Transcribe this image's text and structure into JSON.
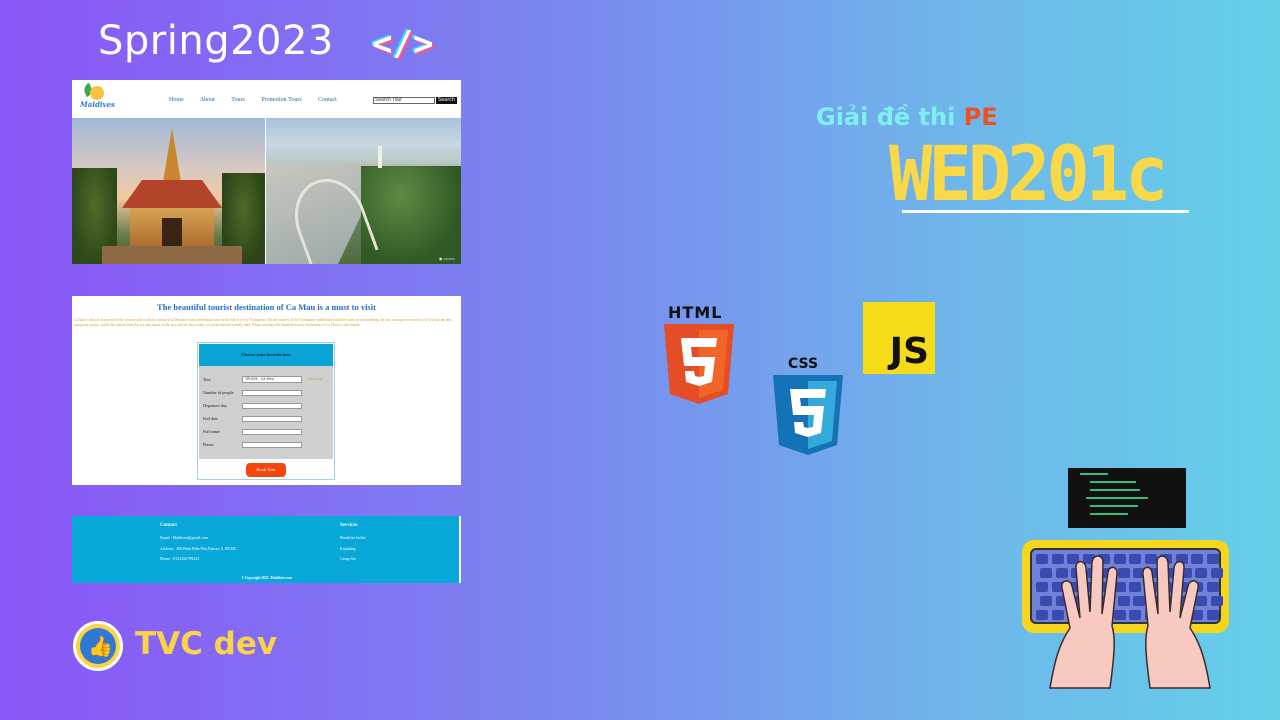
{
  "header": {
    "title": "Spring2023",
    "code_icon": "</>"
  },
  "right": {
    "subtitle_prefix": "Giải đề thi ",
    "subtitle_accent": "PE",
    "course_code": "WED201c"
  },
  "tech": {
    "html_label": "HTML",
    "css_label": "CSS",
    "js_label": "JS"
  },
  "channel": {
    "name": "TVC dev",
    "avatar_icon": "thumbs-up-icon"
  },
  "shot1": {
    "logo_text": "Maldives",
    "nav": [
      "Home",
      "About",
      "Tours",
      "Promotion Tours",
      "Contact"
    ],
    "search_placeholder": "Search Tour",
    "search_button": "Search"
  },
  "shot2": {
    "title": "The beautiful tourist destination of Ca Mau is a must to visit",
    "paragraph": "Ca Mau is known as the end of the country and is always a must-visit Western tourist destination once in the life of every Vietnamese. On the journey of the Vietnamese fatherland with three sides of sea bordering the sea, coming here tourists will visit the ancient mangrove forests, watch the sunrise from the sea and sunset on the sea, and see the scenery of a peaceful and friendly land. Please introduce the beautiful tourist destination of Ca Mau to your friends.",
    "form_title": "Choose your favorite tour",
    "fields": [
      {
        "label": "Tour",
        "value": "TPHCM - Cà Mau"
      },
      {
        "label": "Number of people",
        "value": ""
      },
      {
        "label": "Departure day",
        "value": ""
      },
      {
        "label": "End date",
        "value": ""
      },
      {
        "label": "Full name",
        "value": ""
      },
      {
        "label": "Phone",
        "value": ""
      }
    ],
    "tour_link": "Pricelist",
    "book_button": "Book Tour"
  },
  "shot3": {
    "contact_heading": "Contact",
    "contact_lines": [
      "Email : Maldives@gmail.com",
      "Address : 308 Điện Biên Phủ,District 3, HCMC",
      "Phone : 0123456789222"
    ],
    "services_heading": "Services",
    "services": [
      "Breakfast buffet",
      "Kayaking",
      "Camp fire"
    ],
    "copyright": "© Copyright 2021. Maldives.com"
  }
}
